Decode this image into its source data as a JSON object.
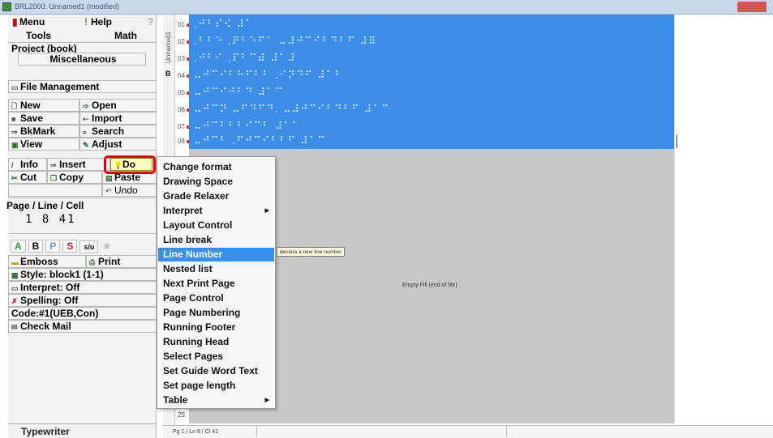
{
  "window": {
    "title": "BRL2000: Unnamed1 (modified)"
  },
  "sidebar": {
    "menu_label": "Menu",
    "help_label": "Help",
    "help_q": "?",
    "tools_label": "Tools",
    "math_label": "Math",
    "project_label": "Project (book)",
    "misc_label": "Miscellaneous",
    "file_mgmt_label": "File Management",
    "buttons": {
      "new": "New",
      "open": "Open",
      "save": "Save",
      "import": "Import",
      "bkmark": "BkMark",
      "search": "Search",
      "view": "View",
      "adjust": "Adjust",
      "info": "Info",
      "insert": "Insert",
      "do": "Do",
      "cut": "Cut",
      "copy": "Copy",
      "paste": "Paste",
      "undo": "Undo"
    },
    "position": {
      "label": "Page / Line / Cell",
      "values": "1  8 41"
    },
    "modes": [
      "A",
      "B",
      "P",
      "S"
    ],
    "mode_fraction": "s/u",
    "emboss": "Emboss",
    "print": "Print",
    "style": "Style: block1 (1-1)",
    "interpret": "Interpret: Off",
    "spelling": "Spelling: Off",
    "code": "Code:#1(UEB,Con)",
    "check_mail": "Check Mail",
    "typewriter": "Typewriter"
  },
  "document": {
    "tab_label": "Unnamed1",
    "bookmark_mark": "B",
    "line_numbers": [
      "01",
      "02",
      "03",
      "04",
      "05",
      "06",
      "07",
      "08",
      "25"
    ],
    "braille_lines": [
      ".⠚⠃⠎⠪    ⠼⠁",
      ".⠃⠃⠑  .⠟⠃⠑⠋⠁  ⠤⠼⠚⠉⠊⠃⠙⠃⠋    ⠼⠿",
      ".⠚⠃⠊   .⠏⠃⠉⠾   ⠼⠁⠼",
      "⠤⠚⠉⠊⠃⠓⠋⠃⠃  .⠊⠝⠙⠋    ⠼⠁⠃",
      "⠤⠚⠉⠊⠚⠃⠙      ⠼⠁⠉",
      "⠤⠚⠉⠝    ⠤⠋⠙⠋⠙.  ⠤⠼⠚⠉⠊⠃⠙⠃⠋    ⠼⠁⠉",
      "⠤⠚⠉⠃⠃⠃⠊⠉⠃    ⠼⠁⠁",
      "⠤⠚⠉⠃  .⠋⠚⠉⠊⠃⠃⠋    ⠼⠁⠉"
    ],
    "empty_fill": "Empty Fill (end of file)",
    "status": "Pg 1 / Ln 8 / Cl 41"
  },
  "context_menu": {
    "items": [
      {
        "label": "Change format",
        "submenu": false
      },
      {
        "label": "Drawing Space",
        "submenu": false
      },
      {
        "label": "Grade Relaxer",
        "submenu": false
      },
      {
        "label": "Interpret",
        "submenu": true
      },
      {
        "label": "Layout Control",
        "submenu": false
      },
      {
        "label": "Line break",
        "submenu": false
      },
      {
        "label": "Line Number",
        "submenu": false,
        "selected": true
      },
      {
        "label": "Nested list",
        "submenu": false
      },
      {
        "label": "Next Print Page",
        "submenu": false
      },
      {
        "label": "Page Control",
        "submenu": false
      },
      {
        "label": "Page Numbering",
        "submenu": false
      },
      {
        "label": "Running Footer",
        "submenu": false
      },
      {
        "label": "Running Head",
        "submenu": false
      },
      {
        "label": "Select Pages",
        "submenu": false
      },
      {
        "label": "Set Guide Word Text",
        "submenu": false
      },
      {
        "label": "Set page length",
        "submenu": false
      },
      {
        "label": "Table",
        "submenu": true
      }
    ],
    "tooltip": "declare a new line number"
  },
  "colors": {
    "selection_blue": "#3c8ee8",
    "menu_highlight": "#3a8ee6",
    "do_highlight_ring": "#e00000",
    "editor_gray": "#c8c8c8"
  }
}
